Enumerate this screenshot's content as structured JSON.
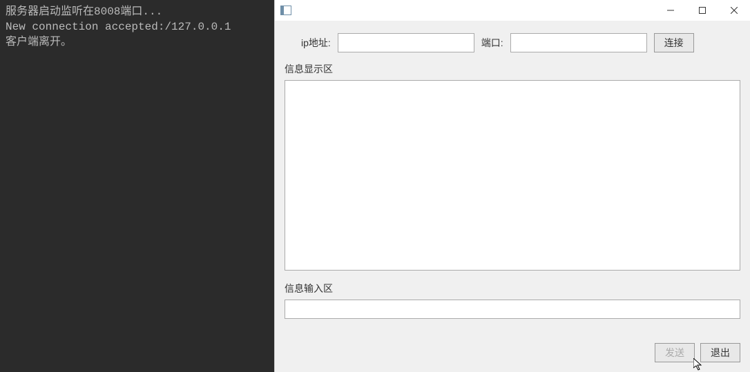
{
  "console": {
    "line1": "服务器启动监听在8008端口...",
    "line2": "New connection accepted:/127.0.0.1",
    "line3": "客户端离开。"
  },
  "window": {
    "title": ""
  },
  "connect": {
    "ip_label": "ip地址:",
    "ip_value": "",
    "port_label": "端口:",
    "port_value": "",
    "connect_btn": "连接"
  },
  "display": {
    "label": "信息显示区",
    "content": ""
  },
  "input": {
    "label": "信息输入区",
    "value": ""
  },
  "buttons": {
    "send": "发送",
    "exit": "退出"
  }
}
